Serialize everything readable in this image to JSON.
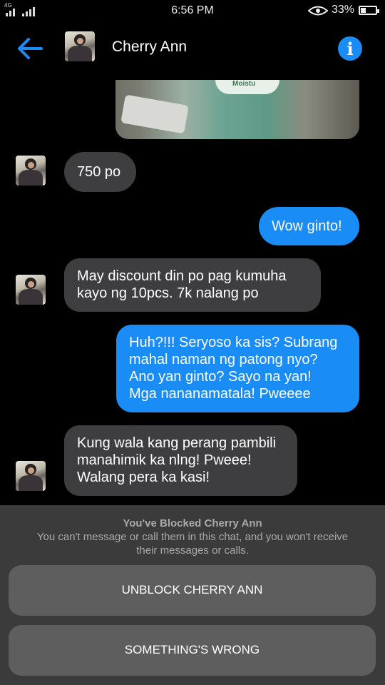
{
  "status_bar": {
    "network": "4G",
    "time": "6:56 PM",
    "battery": "33%"
  },
  "header": {
    "contact_name": "Cherry Ann",
    "info_glyph": "i"
  },
  "messages": [
    {
      "direction": "in",
      "lines": [
        "750 po"
      ]
    },
    {
      "direction": "out",
      "lines": [
        "Wow ginto!"
      ]
    },
    {
      "direction": "in",
      "lines": [
        "May discount din po pag kumuha",
        "kayo ng 10pcs. 7k nalang po"
      ]
    },
    {
      "direction": "out",
      "lines": [
        "Huh?!!! Seryoso ka sis? Subrang",
        "mahal naman ng patong nyo?",
        "Ano yan ginto? Sayo na yan!",
        "Mga nananamatala! Pweeee"
      ]
    },
    {
      "direction": "in",
      "lines": [
        "Kung wala kang perang pambili",
        "manahimik ka nlng! Pweee!",
        "Walang pera ka kasi!"
      ]
    }
  ],
  "photo_label": "Moistu",
  "blocked": {
    "title": "You've Blocked Cherry Ann",
    "desc_lines": [
      "You can't message or call them in this chat, and you won't receive",
      "their messages or calls."
    ],
    "unblock_label": "UNBLOCK CHERRY ANN",
    "wrong_label": "SOMETHING'S WRONG"
  },
  "colors": {
    "accent": "#1a8cf5",
    "incoming_bubble": "#3e3e40",
    "panel": "#3b3b3b",
    "panel_button": "#5e5e5e"
  },
  "icons": [
    "signal-icon",
    "eye-icon",
    "battery-icon",
    "back-arrow-icon",
    "info-icon"
  ]
}
